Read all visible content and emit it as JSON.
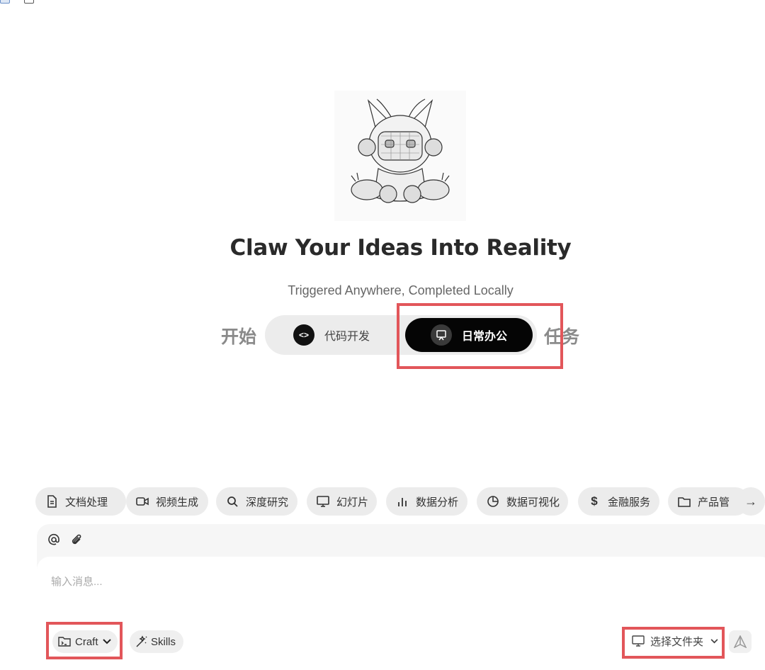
{
  "hero": {
    "title": "Claw Your Ideas Into Reality",
    "subtitle": "Triggered Anywhere, Completed Locally",
    "start_label": "开始",
    "task_label": "任务",
    "modes": [
      {
        "label": "代码开发",
        "icon": "code-icon",
        "selected": false
      },
      {
        "label": "日常办公",
        "icon": "presentation-icon",
        "selected": true
      }
    ]
  },
  "chips": [
    {
      "label": "文档处理",
      "icon": "document-icon"
    },
    {
      "label": "视频生成",
      "icon": "video-icon"
    },
    {
      "label": "深度研究",
      "icon": "search-icon"
    },
    {
      "label": "幻灯片",
      "icon": "monitor-icon"
    },
    {
      "label": "数据分析",
      "icon": "bar-chart-icon"
    },
    {
      "label": "数据可视化",
      "icon": "pie-chart-icon"
    },
    {
      "label": "金融服务",
      "icon": "dollar-icon"
    },
    {
      "label": "产品管",
      "icon": "folder-icon"
    }
  ],
  "composer": {
    "placeholder": "输入消息...",
    "mode_label": "Craft",
    "skills_label": "Skills",
    "folder_label": "选择文件夹"
  },
  "colors": {
    "accent": "#050505",
    "highlight": "#e2565a",
    "chip_bg": "#ececec"
  }
}
